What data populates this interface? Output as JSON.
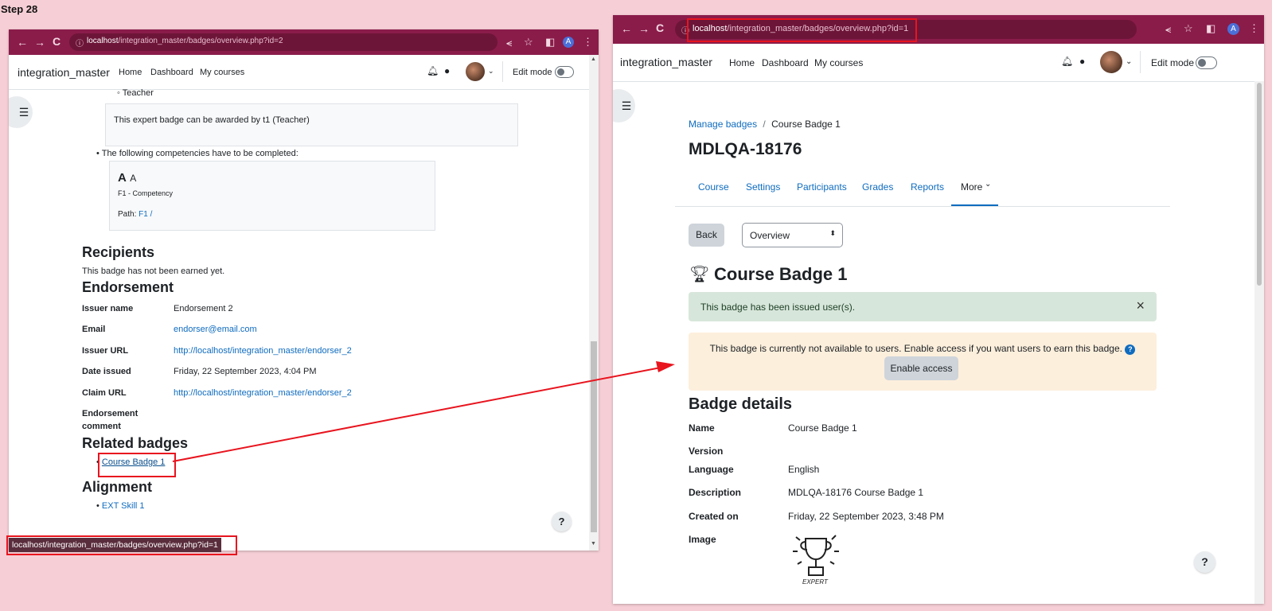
{
  "step_label": "Step 28",
  "colors": {
    "browser_bar": "#8a1c4a",
    "annotation": "#e8141e",
    "link": "#0f6cbf",
    "success_bg": "#d7e6da",
    "warning_bg": "#fcefdc"
  },
  "left": {
    "url_host": "localhost",
    "url_path": "/integration_master/badges/overview.php?id=2",
    "avatar_letter": "A",
    "site_name": "integration_master",
    "nav": [
      "Home",
      "Dashboard",
      "My courses"
    ],
    "edit_mode": "Edit mode",
    "teacher_item": "Teacher",
    "award_note": "This expert badge can be awarded by t1 (Teacher)",
    "competencies_intro": "The following competencies have to be completed:",
    "competency_title": "A",
    "competency_title_small": "A",
    "competency_sub": "F1 - Competency",
    "path_label": "Path:",
    "path_link": "F1",
    "path_sep": "/",
    "recipients_heading": "Recipients",
    "recipients_text": "This badge has not been earned yet.",
    "endorsement_heading": "Endorsement",
    "endorsement": {
      "issuer_name_label": "Issuer name",
      "issuer_name": "Endorsement 2",
      "email_label": "Email",
      "email": "endorser@email.com",
      "issuer_url_label": "Issuer URL",
      "issuer_url": "http://localhost/integration_master/endorser_2",
      "date_label": "Date issued",
      "date": "Friday, 22 September 2023, 4:04 PM",
      "claim_label": "Claim URL",
      "claim_url": "http://localhost/integration_master/endorser_2",
      "comment_label_1": "Endorsement",
      "comment_label_2": "comment"
    },
    "related_heading": "Related badges",
    "related_link": "Course Badge 1",
    "alignment_heading": "Alignment",
    "alignment_link": "EXT Skill 1",
    "status_url": "localhost/integration_master/badges/overview.php?id=1",
    "help": "?"
  },
  "right": {
    "url_host": "localhost",
    "url_path": "/integration_master/badges/overview.php?id=1",
    "avatar_letter": "A",
    "site_name": "integration_master",
    "nav": [
      "Home",
      "Dashboard",
      "My courses"
    ],
    "edit_mode": "Edit mode",
    "breadcrumb_link": "Manage badges",
    "breadcrumb_sep": "/",
    "breadcrumb_current": "Course Badge 1",
    "page_title": "MDLQA-18176",
    "tabs": [
      "Course",
      "Settings",
      "Participants",
      "Grades",
      "Reports",
      "More"
    ],
    "back_button": "Back",
    "select_value": "Overview",
    "badge_title": "Course Badge 1",
    "success_msg": "This badge has been issued user(s).",
    "close_glyph": "×",
    "warning_msg": "This badge is currently not available to users. Enable access if you want users to earn this badge.",
    "info_glyph": "?",
    "enable_button": "Enable access",
    "details_heading": "Badge details",
    "details": {
      "name_label": "Name",
      "name": "Course Badge 1",
      "version_label": "Version",
      "language_label": "Language",
      "language": "English",
      "description_label": "Description",
      "description": "MDLQA-18176 Course Badge 1",
      "created_label": "Created on",
      "created": "Friday, 22 September 2023, 3:48 PM",
      "image_label": "Image"
    },
    "badge_image_text": "EXPERT",
    "help": "?"
  }
}
